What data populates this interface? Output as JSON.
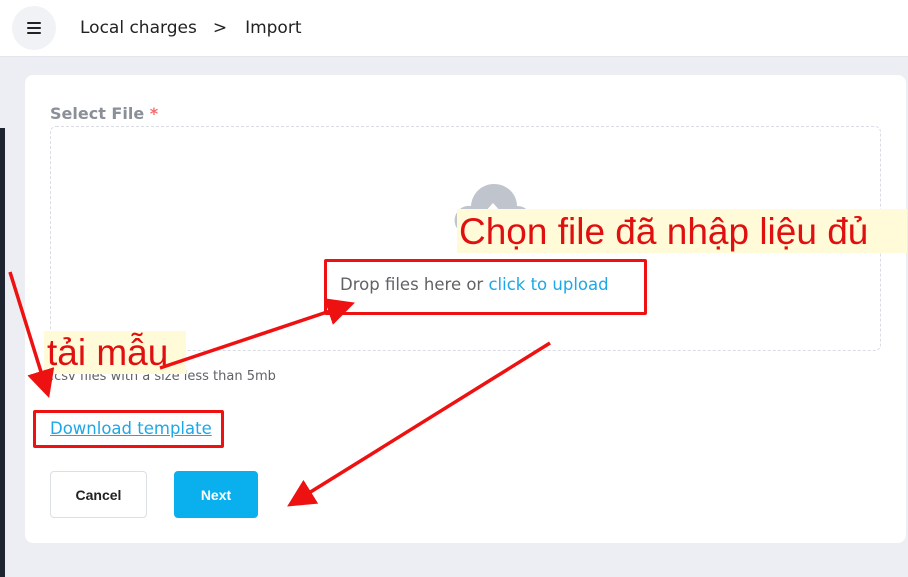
{
  "header": {
    "breadcrumb": [
      "Local charges",
      "Import"
    ],
    "separator": ">"
  },
  "form": {
    "label": "Select File",
    "required_mark": "*",
    "dropzone": {
      "text": "Drop files here or ",
      "link": "click to upload",
      "icon": "cloud-upload-icon"
    },
    "tip": ".csv files with a size less than 5mb",
    "download_link": "Download template",
    "buttons": {
      "cancel": "Cancel",
      "next": "Next"
    }
  },
  "annotations": {
    "choose_file_note": "Chọn file đã nhập liệu đủ",
    "template_note": "tải mẫu",
    "color": "#ee1111"
  },
  "colors": {
    "accent": "#0ab0ee",
    "link": "#1ea7e6",
    "required": "#f56c6c"
  }
}
